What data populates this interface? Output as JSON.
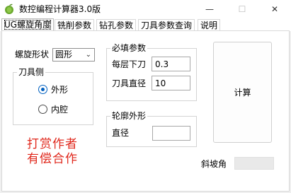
{
  "window": {
    "title": "数控编程计算器3.0版",
    "icon": "leaf-app-icon",
    "controls": {
      "minimize": "—",
      "maximize": "☐",
      "close": "✕"
    }
  },
  "tabs": [
    {
      "label": "UG螺旋角度",
      "active": true
    },
    {
      "label": "铣削参数",
      "active": false
    },
    {
      "label": "钻孔参数",
      "active": false
    },
    {
      "label": "刀具参数查询",
      "active": false
    },
    {
      "label": "说明",
      "active": false
    }
  ],
  "spiral": {
    "shape_label": "螺旋形状",
    "shape_value": "圆形"
  },
  "tool_side": {
    "title": "刀具侧",
    "options": [
      {
        "label": "外形",
        "checked": true
      },
      {
        "label": "内腔",
        "checked": false
      }
    ]
  },
  "required": {
    "title": "必填参数",
    "step_down_label": "每层下刀",
    "step_down_value": "0.3",
    "tool_diameter_label": "刀具直径",
    "tool_diameter_value": "10"
  },
  "profile": {
    "title": "轮廓外形",
    "diameter_label": "直径",
    "diameter_value": ""
  },
  "calculate_label": "计算",
  "promo_lines": [
    "打赏作者",
    "有偿合作"
  ],
  "slope": {
    "label": "斜坡角",
    "value": ""
  },
  "colors": {
    "accent": "#0060c0",
    "promo": "#e0281c",
    "title_bar": "#ffffff"
  }
}
